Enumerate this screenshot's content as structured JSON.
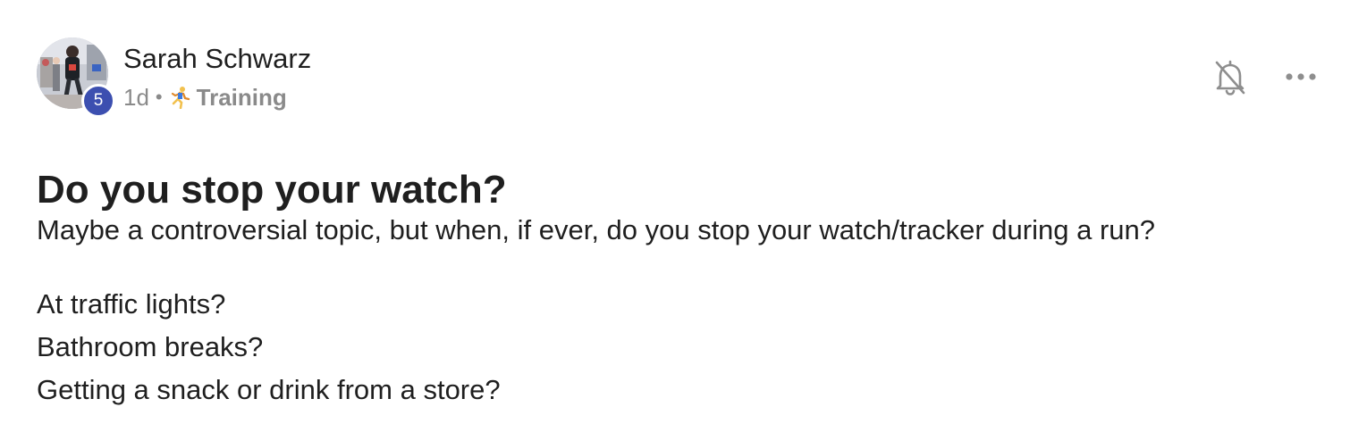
{
  "author": {
    "name": "Sarah Schwarz",
    "level": "5",
    "avatar": "runner-photo"
  },
  "meta": {
    "time": "1d",
    "separator": "•",
    "category_icon": "runner-emoji-icon",
    "category": "Training"
  },
  "actions": {
    "notify_icon": "bell-off-icon",
    "more_icon": "more-horizontal-icon"
  },
  "post": {
    "title": "Do you stop your watch?",
    "paragraph1": "Maybe a controversial topic, but when, if ever, do you stop your watch/tracker during a run?",
    "lines": [
      "At traffic lights?",
      "Bathroom breaks?",
      "Getting a snack or drink from a store?"
    ]
  },
  "colors": {
    "text": "#1f1f1f",
    "muted": "#8a8a8a",
    "badge": "#3c4fb0"
  }
}
